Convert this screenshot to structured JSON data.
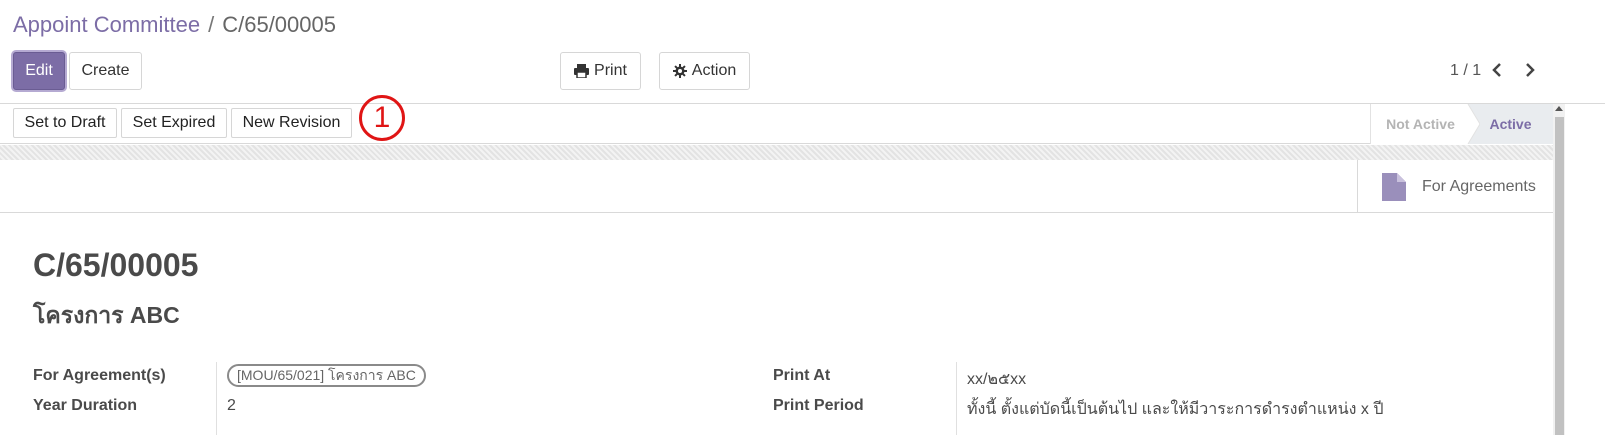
{
  "breadcrumb": {
    "parent": "Appoint Committee",
    "separator": "/",
    "current": "C/65/00005"
  },
  "toolbar": {
    "edit_label": "Edit",
    "create_label": "Create",
    "print_label": "Print",
    "action_label": "Action"
  },
  "pager": {
    "value": "1 / 1"
  },
  "statusbar": {
    "buttons": [
      "Set to Draft",
      "Set Expired",
      "New Revision"
    ],
    "annotation_marker": "1",
    "stages": [
      {
        "label": "Not Active",
        "active": false
      },
      {
        "label": "Active",
        "active": true
      }
    ]
  },
  "smart_button": {
    "label": "For Agreements",
    "icon": "file-icon"
  },
  "record": {
    "title": "C/65/00005",
    "subtitle": "โครงการ ABC",
    "fields_left": [
      {
        "label": "For Agreement(s)",
        "value": "[MOU/65/021] โครงการ ABC"
      },
      {
        "label": "Year Duration",
        "value": "2"
      }
    ],
    "fields_right": [
      {
        "label": "Print At",
        "value": "xx/๒๕xx"
      },
      {
        "label": "Print Period",
        "value": "ทั้งนี้ ตั้งแต่บัดนี้เป็นต้นไป และให้มีวาระการดำรงตำแหน่ง x ปี"
      }
    ]
  },
  "colors": {
    "primary": "#7c6da6",
    "annotation": "#e01515"
  }
}
